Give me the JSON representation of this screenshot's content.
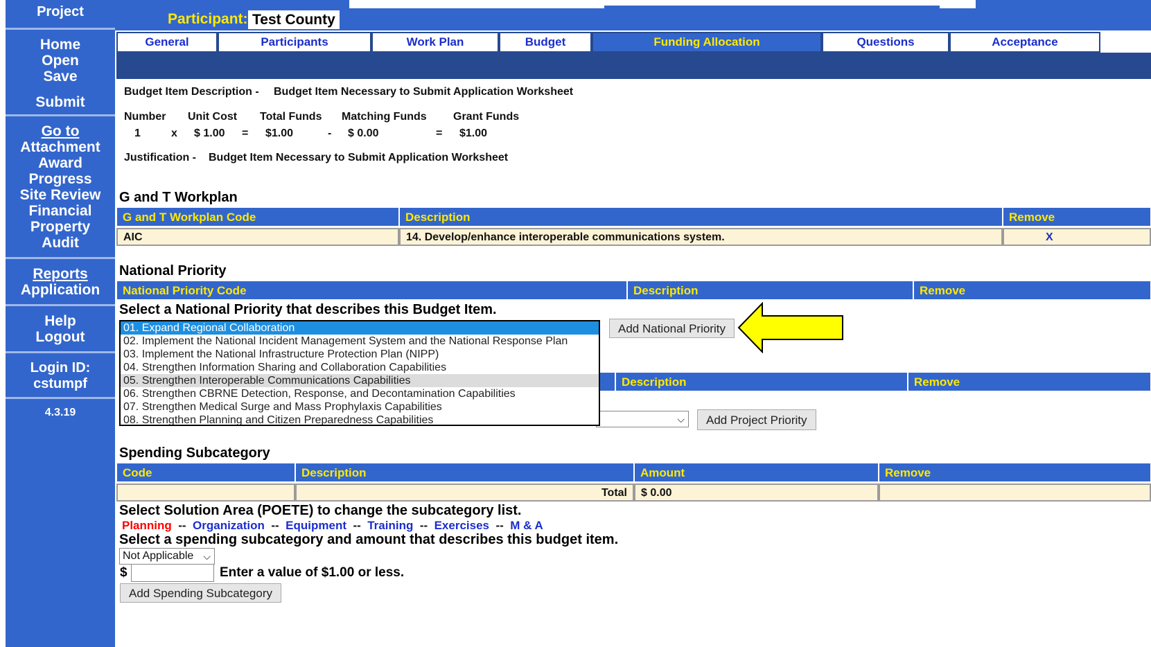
{
  "colors": {
    "sidebar_bg": "#3366cc",
    "header_text": "#ffe900",
    "header_bg": "#3366cc",
    "row_bg": "#fdf3d6",
    "selected_option": "#1e8fe0",
    "arrow": "#ffff00"
  },
  "sidebar": {
    "project": "Project",
    "home": "Home",
    "open": "Open",
    "save": "Save",
    "submit": "Submit",
    "goto": "Go to",
    "attachment": "Attachment",
    "award": "Award",
    "progress": "Progress",
    "site_review": "Site Review",
    "financial": "Financial",
    "property": "Property",
    "audit": "Audit",
    "reports": "Reports",
    "application": "Application",
    "help": "Help",
    "logout": "Logout",
    "login_label": "Login ID:",
    "login_id": "cstumpf",
    "version": "4.3.19"
  },
  "header": {
    "participant_label": "Participant:",
    "participant_value": "Test County"
  },
  "tabs": [
    "General",
    "Participants",
    "Work Plan",
    "Budget",
    "Funding Allocation",
    "Questions",
    "Acceptance"
  ],
  "budget_item": {
    "desc_label": "Budget Item Description -",
    "desc_value": "Budget Item Necessary to Submit Application Worksheet",
    "number_label": "Number",
    "unit_cost_label": "Unit Cost",
    "total_funds_label": "Total Funds",
    "matching_funds_label": "Matching Funds",
    "grant_funds_label": "Grant Funds",
    "number": "1",
    "op_x": "x",
    "unit_cost": "$ 1.00",
    "op_eq1": "=",
    "total_funds": "$1.00",
    "op_minus": "-",
    "matching_funds": "$ 0.00",
    "op_eq2": "=",
    "grant_funds": "$1.00",
    "just_label": "Justification -",
    "just_value": "Budget Item Necessary to Submit Application Worksheet"
  },
  "workplan": {
    "title": "G and T Workplan",
    "col_code": "G and T Workplan Code",
    "col_desc": "Description",
    "col_remove": "Remove",
    "row_code": "AIC",
    "row_desc": "14. Develop/enhance interoperable communications system.",
    "row_remove": "X"
  },
  "national_priority": {
    "title": "National Priority",
    "col_code": "National Priority Code",
    "col_desc": "Description",
    "col_remove": "Remove",
    "prompt": "Select a National Priority that describes this Budget Item.",
    "options": [
      "01. Expand Regional Collaboration",
      "02. Implement the National Incident Management System and the National Response Plan",
      "03. Implement the National Infrastructure Protection Plan (NIPP)",
      "04. Strengthen Information Sharing and Collaboration Capabilities",
      "05. Strengthen Interoperable Communications Capabilities",
      "06. Strengthen CBRNE Detection, Response, and Decontamination Capabilities",
      "07. Strengthen Medical Surge and Mass Prophylaxis Capabilities",
      "08. Strengthen Planning and Citizen Preparedness Capabilities"
    ],
    "add_button": "Add National Priority"
  },
  "project_priority": {
    "col_desc": "Description",
    "col_remove": "Remove",
    "add_button": "Add Project Priority"
  },
  "spending": {
    "title": "Spending Subcategory",
    "col_code": "Code",
    "col_desc": "Description",
    "col_amount": "Amount",
    "col_remove": "Remove",
    "total_label": "Total",
    "total_value": "$ 0.00",
    "poete_prompt": "Select Solution Area (POETE) to change the subcategory list.",
    "poete_planning": "Planning",
    "sep": "--",
    "poete_organization": "Organization",
    "poete_equipment": "Equipment",
    "poete_training": "Training",
    "poete_exercises": "Exercises",
    "poete_ma": "M & A",
    "sub_prompt": "Select a spending subcategory and amount that describes this budget item.",
    "sub_select": "Not Applicable",
    "dollar": "$",
    "amount_hint": "Enter a value of $1.00 or less.",
    "add_button": "Add Spending Subcategory"
  }
}
